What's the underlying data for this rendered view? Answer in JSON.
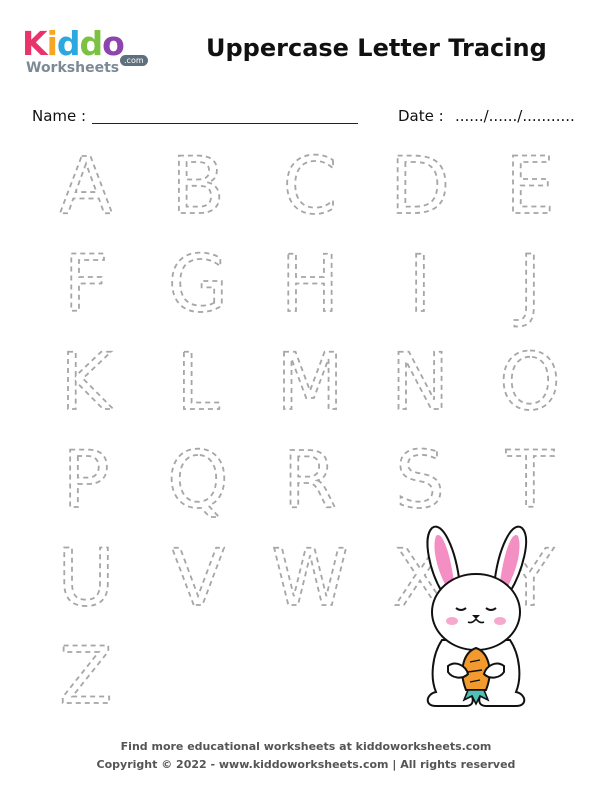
{
  "logo": {
    "brand_letters": [
      "K",
      "i",
      "d",
      "d",
      "o"
    ],
    "brand_colors": [
      "#e8336b",
      "#f5a623",
      "#2ba8e0",
      "#7cc242",
      "#8e44ad"
    ],
    "sub": "Worksheets",
    "dot": ".com"
  },
  "header": {
    "title": "Uppercase Letter Tracing"
  },
  "form": {
    "name_label": "Name :",
    "date_label": "Date :",
    "date_fill": "....../....../..........."
  },
  "letters": [
    "A",
    "B",
    "C",
    "D",
    "E",
    "F",
    "G",
    "H",
    "I",
    "J",
    "K",
    "L",
    "M",
    "N",
    "O",
    "P",
    "Q",
    "R",
    "S",
    "T",
    "U",
    "V",
    "W",
    "X",
    "Y",
    "Z"
  ],
  "colors": {
    "trace": "#a6a6a6",
    "ear_inner": "#f48fc4",
    "cheek": "#f7a8cf",
    "carrot": "#f39a2e",
    "carrot_leaf": "#4fc1b6"
  },
  "footer": {
    "line1": "Find more educational worksheets at kiddoworksheets.com",
    "line2": "Copyright © 2022 - www.kiddoworksheets.com  |  All rights reserved"
  }
}
